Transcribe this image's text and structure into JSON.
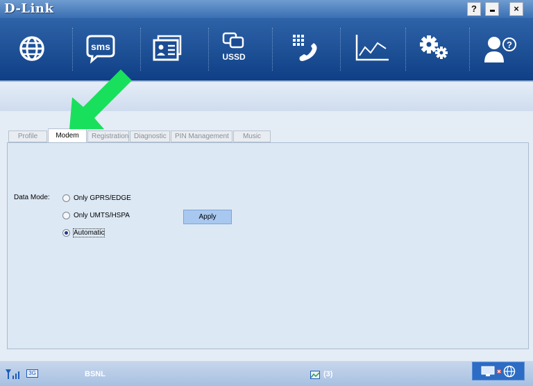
{
  "app": {
    "logo": "D-Link"
  },
  "window": {
    "help": "?",
    "close": "×"
  },
  "toolbar": {
    "items": [
      {
        "name": "internet",
        "icon": "globe-icon"
      },
      {
        "name": "sms",
        "icon": "sms-icon",
        "label": "sms"
      },
      {
        "name": "contacts",
        "icon": "contacts-icon"
      },
      {
        "name": "ussd",
        "icon": "ussd-icon",
        "label": "USSD"
      },
      {
        "name": "phone",
        "icon": "dialpad-phone-icon"
      },
      {
        "name": "statistics",
        "icon": "line-chart-icon"
      },
      {
        "name": "settings",
        "icon": "gears-icon"
      },
      {
        "name": "help",
        "icon": "user-help-icon"
      }
    ]
  },
  "tabs": [
    {
      "label": "Profile"
    },
    {
      "label": "Modem",
      "active": true
    },
    {
      "label": "Registration"
    },
    {
      "label": "Diagnostic"
    },
    {
      "label": "PIN Management"
    },
    {
      "label": "Music"
    }
  ],
  "form": {
    "data_mode_label": "Data Mode:",
    "options": [
      {
        "label": "Only GPRS/EDGE",
        "checked": false
      },
      {
        "label": "Only UMTS/HSPA",
        "checked": false
      },
      {
        "label": "Automatic",
        "checked": true
      }
    ],
    "apply_label": "Apply"
  },
  "status": {
    "network_type": "3G",
    "carrier": "BSNL",
    "message_count": "(3)"
  },
  "colors": {
    "title_bar": "#3a6fb3",
    "toolbar": "#1a4c94",
    "panel": "#dce8f4",
    "apply_button": "#a8c8f0",
    "arrow": "#19e05c"
  }
}
